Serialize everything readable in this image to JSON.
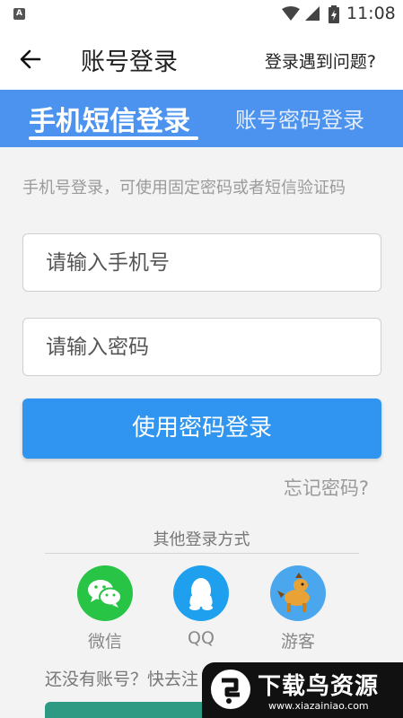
{
  "status_bar": {
    "left_icon_letter": "A",
    "time": "11:08"
  },
  "header": {
    "title": "账号登录",
    "help_link": "登录遇到问题?",
    "back_icon": "arrow-left-icon"
  },
  "tabs": [
    {
      "label": "手机短信登录",
      "active": true
    },
    {
      "label": "账号密码登录",
      "active": false
    }
  ],
  "form": {
    "hint": "手机号登录，可使用固定密码或者短信验证码",
    "phone_placeholder": "请输入手机号",
    "password_placeholder": "请输入密码",
    "submit_label": "使用密码登录",
    "forgot_label": "忘记密码?"
  },
  "other_login": {
    "title": "其他登录方式",
    "options": [
      {
        "label": "微信",
        "icon": "wechat-icon"
      },
      {
        "label": "QQ",
        "icon": "qq-icon"
      },
      {
        "label": "游客",
        "icon": "guest-horse-icon"
      }
    ]
  },
  "register_prompt": "还没有账号？快去注",
  "watermark": {
    "title": "下载鸟资源",
    "url": "www.xiazainiao.com"
  },
  "colors": {
    "tab_bar": "#4c93f0",
    "primary_button": "#2f95f0",
    "wechat": "#28c445",
    "qq": "#1ea0ef"
  }
}
